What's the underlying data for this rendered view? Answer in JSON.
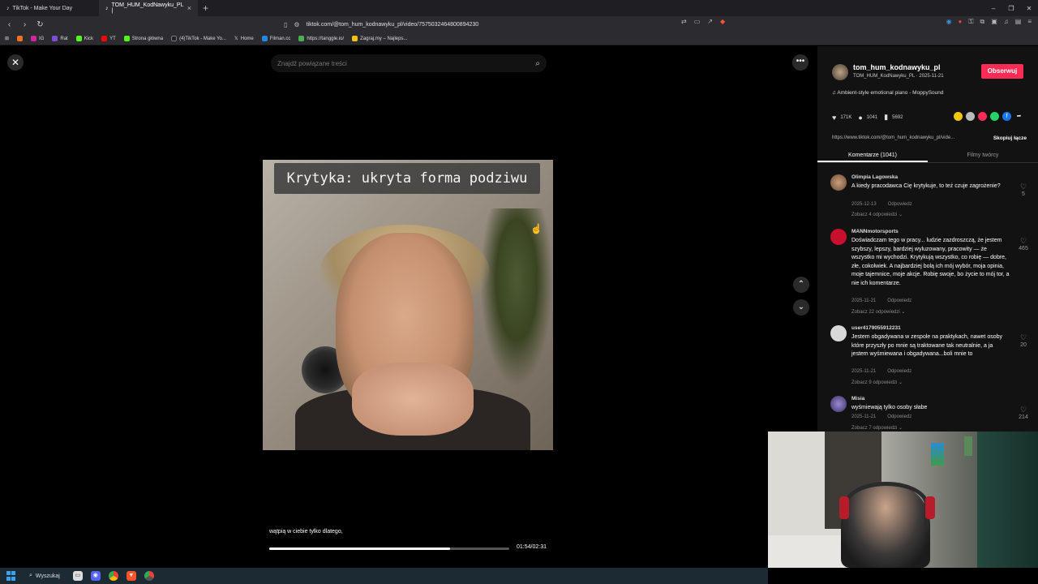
{
  "browser": {
    "tabs": [
      {
        "label": "TikTok - Make Your Day",
        "active": false
      },
      {
        "label": "TOM_HUM_KodNawyku_PL |",
        "active": true
      }
    ],
    "url": "tiktok.com/@tom_hum_kodnawyku_pl/video/7575032464800894230",
    "bookmarks": [
      "IG",
      "Rat",
      "Kick",
      "YT",
      "Strona główna",
      "(4)TikTok - Make Yo...",
      "Home",
      "Filman.cc",
      "https://tanggle.io/",
      "Zagraj.my – Najleps..."
    ]
  },
  "page": {
    "search_placeholder": "Znajdź powiązane treści",
    "video_overlay_title": "Krytyka: ukryta forma podziwu",
    "caption": "wątpią w ciebie tylko dlatego,",
    "timer": "01:54/02:31",
    "progress": 0.755
  },
  "panel": {
    "author_name": "tom_hum_kodnawyku_pl",
    "author_sub": "TOM_HUM_KodNawyku_PL · 2025-11-21",
    "follow_label": "Obserwuj",
    "music": "Ambient-style emotional piano - MoppySound",
    "likes": "171K",
    "comments_count": "1041",
    "saves": "5692",
    "link": "https://www.tiktok.com/@tom_hum_kodnawyku_pl/vide...",
    "copy_label": "Skopiuj łącze",
    "tab_comments": "Komentarze (1041)",
    "tab_creator": "Filmy twórcy",
    "comments": [
      {
        "user": "Olimpia Lagowska",
        "text": "A kiedy pracodawca Cię krytykuje, to też czuje zagrożenie?",
        "date": "2025-12-13",
        "reply": "Odpowiedz",
        "more": "Zobacz 4 odpowiedzi",
        "likes": "5"
      },
      {
        "user": "MANNmotorsports",
        "text": "Doświadczam tego w pracy... ludzie zazdroszczą, że jestem szybszy, lepszy, bardziej wyluzowany, pracowity — że wszystko mi wychodzi. Krytykują wszystko, co robię — dobre, złe, cokolwiek. A najbardziej bolą ich mój wybór, moja opinia, moje tajemnice, moje akcje. Robię swoje, bo życie to mój tor, a nie ich komentarze.",
        "date": "2025-11-21",
        "reply": "Odpowiedz",
        "more": "Zobacz 22 odpowiedzi",
        "likes": "465"
      },
      {
        "user": "user4179055912231",
        "text": "Jestem obgadywana w zespole na praktykach, nawet osoby które przyszły po mnie są traktowane tak neutralnie, a ja jestem wyśmiewana i obgadywana...boli mnie to",
        "date": "2025-11-21",
        "reply": "Odpowiedz",
        "more": "Zobacz 9 odpowiedzi",
        "likes": "20"
      },
      {
        "user": "Misia",
        "text": "wyśmiewają tylko osoby słabe",
        "date": "2025-11-21",
        "reply": "Odpowiedz",
        "more": "Zobacz 7 odpowiedzi",
        "likes": "214"
      }
    ]
  },
  "taskbar": {
    "search_label": "Wyszukaj"
  },
  "colors": {
    "accent": "#fe2c55",
    "panel_bg": "#121212"
  }
}
